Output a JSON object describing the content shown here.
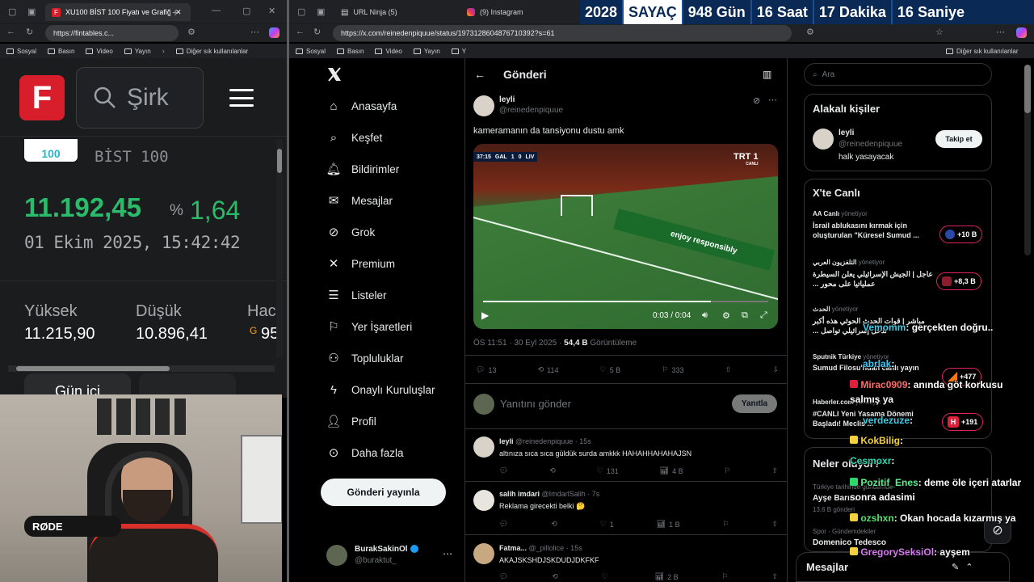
{
  "left_browser": {
    "tab_title": "XU100 BİST 100 Fiyatı ve Grafiği",
    "url": "https://fintables.c...",
    "bookmarks": [
      "Sosyal",
      "Basın",
      "Video",
      "Yayın"
    ],
    "bookmark_more": "Diğer sık kullanılanlar"
  },
  "fintables": {
    "logo_letter": "F",
    "search_text": "Şirk",
    "index_badge": "100",
    "index_name": "BİST 100",
    "price": "11.192,45",
    "change_pct_sign": "%",
    "change_pct": "1,64",
    "datetime": "01 Ekim 2025, 15:42:42",
    "high_label": "Yüksek",
    "high_value": "11.215,90",
    "low_label": "Düşük",
    "low_value": "10.896,41",
    "third_label": "Hac",
    "third_value": "95",
    "third_prefix": "G",
    "gun_ici": "Gün içi"
  },
  "right_browser": {
    "tab1": "URL Ninja (5)",
    "tab2": "(9) Instagram",
    "url": "https://x.com/reinedenpiquue/status/1973128604876710392?s=61",
    "bookmarks": [
      "Sosyal",
      "Basın",
      "Video",
      "Yayın",
      "Y"
    ],
    "bookmark_more": "Diğer sık kullanılanlar"
  },
  "counter": {
    "year": "2028",
    "label": "SAYAÇ",
    "days": "948 Gün",
    "hours": "16 Saat",
    "minutes": "17 Dakika",
    "seconds": "16 Saniye"
  },
  "x_nav": {
    "items": [
      "Anasayfa",
      "Keşfet",
      "Bildirimler",
      "Mesajlar",
      "Grok",
      "Premium",
      "Listeler",
      "Yer İşaretleri",
      "Topluluklar",
      "Onaylı Kuruluşlar",
      "Profil",
      "Daha fazla"
    ],
    "post_button": "Gönderi yayınla",
    "account_name": "BurakSakinOl",
    "account_handle": "@buraktut_"
  },
  "post": {
    "header": "Gönderi",
    "author": "leyli",
    "handle": "@reinedenpiquue",
    "text": "kameramanın da tansiyonu dustu amk",
    "video_time": "0:03 / 0:04",
    "score": {
      "home": "GAL",
      "away": "LIV",
      "home_score": "1",
      "away_score": "0",
      "clock": "37:15"
    },
    "channel": "TRT 1",
    "channel_sub": "CANLI",
    "ad_text": "enjoy responsibly",
    "meta_time": "ÖS 11:51 · 30 Eyl 2025 ·",
    "views": "54,4 B",
    "views_label": "Görüntüleme",
    "replies": "13",
    "retweets": "114",
    "likes": "5 B",
    "bookmarks": "333",
    "reply_placeholder": "Yanıtını gönder",
    "reply_button": "Yanıtla"
  },
  "replies": [
    {
      "name": "leyli",
      "handle": "@reinedenpiquue · 15s",
      "text": "altınıza sıca sıca güldük surda amkkk HAHAHHAHAHAJSN",
      "r": "",
      "rt": "",
      "l": "131",
      "v": "4 B"
    },
    {
      "name": "salih imdari",
      "handle": "@ImdarlSalih · 7s",
      "text": "Reklama girecekti belki 🤔",
      "r": "",
      "rt": "",
      "l": "1",
      "v": "1 B"
    },
    {
      "name": "Fatma...",
      "handle": "@_pillolice · 15s",
      "text": "AKAJSKSHDJSKDUDJDKFKF",
      "r": "",
      "rt": "",
      "l": "",
      "v": "2 B"
    }
  ],
  "sidebar": {
    "search_placeholder": "Ara",
    "related_title": "Alakalı kişiler",
    "person_name": "leyli",
    "person_handle": "@reinedenpiquue",
    "person_bio": "halk yasayacak",
    "follow": "Takip et",
    "live_title": "X'te Canlı",
    "live": [
      {
        "source": "AA Canlı",
        "status": "yönetiyor",
        "text": "İsrail ablukasını kırmak için oluşturulan \"Küresel Sumud ...",
        "count": "+10 B"
      },
      {
        "source": "التلفزيون العربي",
        "status": "yönetiyor",
        "text": "عاجل | الجيش الإسرائيلي يعلن السيطرة عملياتيا على محور ...",
        "count": "+8,3 B"
      },
      {
        "source": "الحدث",
        "status": "yönetiyor",
        "text": "مباشر | قوات الحدث الحوثي هذه أكبر تدخل إسرائيلي تواصل ...",
        "count": ""
      },
      {
        "source": "Sputnik Türkiye",
        "status": "yönetiyor",
        "text": "Sumud Filosu'ndan canlı yayın",
        "count": "+477"
      },
      {
        "source": "Haberler.com",
        "status": "yönetiyor",
        "text": "#CANLI Yeni Yasama Dönemi Başladı! Meclis ...",
        "count": "+191"
      }
    ],
    "trends_title": "Neler oluyor?",
    "trends": [
      {
        "cat": "Türkiye tarihinde gündemde",
        "name": "Ayşe Barım",
        "posts": "13,6 B gönderi"
      },
      {
        "cat": "Spor · Gündemdekiler",
        "name": "Domenico Tedesco",
        "posts": ""
      }
    ],
    "messages": "Mesajlar"
  },
  "chat": [
    {
      "user": "Vemomm",
      "msg": "gerçekten doğru.."
    },
    {
      "user": "abrlak",
      "msg": ""
    },
    {
      "user": "Mirac0909",
      "msg": "anında göt korkusu salmış ya"
    },
    {
      "user": "verdezuze",
      "msg": ""
    },
    {
      "user": "KokBilig",
      "msg": ""
    },
    {
      "user": "Cesmoxr",
      "msg": ""
    },
    {
      "user": "Pozitif_Enes",
      "msg": "deme öle içeri atarlar sonra adasimi"
    },
    {
      "user": "ozshxn",
      "msg": "Okan hocada kızarmış ya"
    },
    {
      "user": "GregorySeksiOl",
      "msg": "ayşem"
    }
  ],
  "webcam": {
    "mic_brand": "RØDE"
  }
}
